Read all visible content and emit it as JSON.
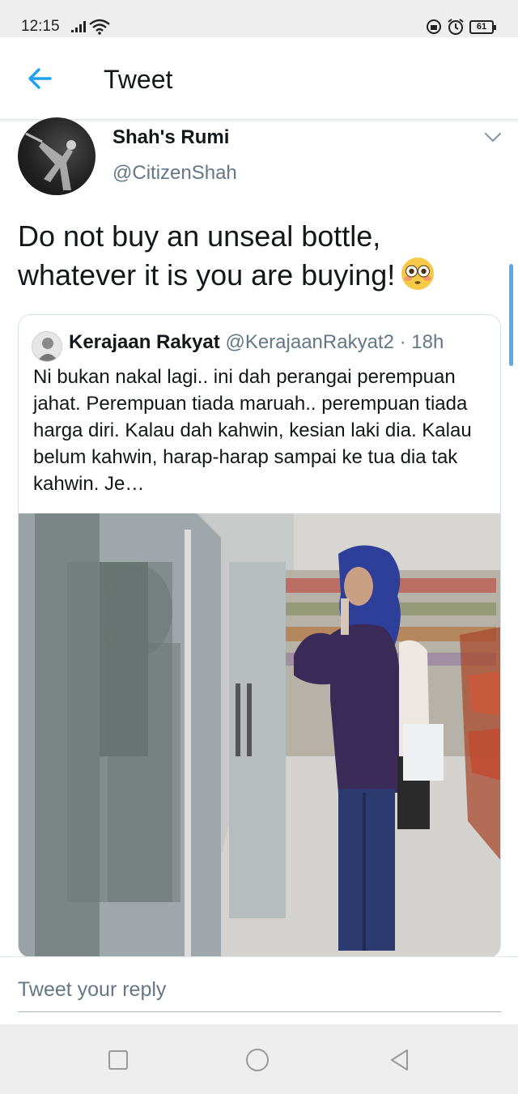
{
  "status_bar": {
    "time": "12:15",
    "battery": "61"
  },
  "header": {
    "title": "Tweet"
  },
  "tweet": {
    "display_name": "Shah's Rumi",
    "handle": "@CitizenShah",
    "text": "Do not buy an unseal bottle, whatever it is you are buying!",
    "emoji": "flushed-face-icon"
  },
  "quoted_tweet": {
    "display_name": "Kerajaan Rakyat",
    "handle": "@KerajaanRakyat2",
    "time": "· 18h",
    "text": "Ni bukan nakal lagi.. ini dah perangai perempuan jahat. Perempuan tiada maruah.. perempuan tiada harga diri. Kalau dah kahwin, kesian laki dia. Kalau belum kahwin, harap-harap sampai ke tua dia tak kahwin. Je…"
  },
  "reply": {
    "placeholder": "Tweet your reply"
  },
  "colors": {
    "accent": "#1da1f2",
    "text_primary": "#14171a",
    "text_secondary": "#657786",
    "border": "#e1e8ed"
  }
}
